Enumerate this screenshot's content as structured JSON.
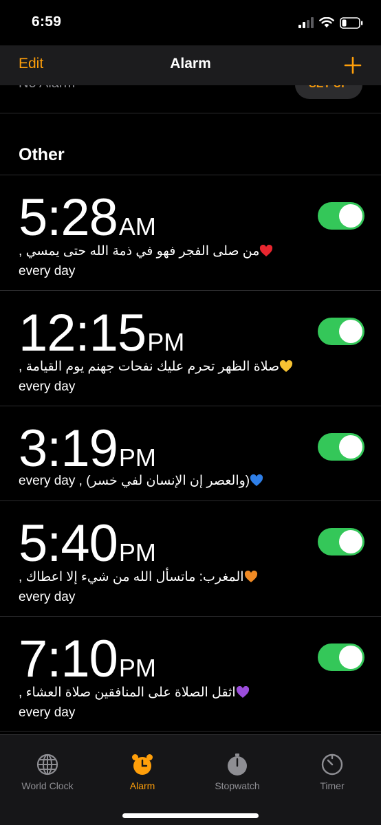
{
  "status": {
    "time": "6:59"
  },
  "nav": {
    "edit_label": "Edit",
    "title": "Alarm"
  },
  "peek": {
    "label": "No Alarm",
    "button": "SET UP"
  },
  "section": {
    "title": "Other"
  },
  "alarms": [
    {
      "time": "5:28",
      "ampm": "AM",
      "label": "من صلى الفجر فهو في ذمة الله حتى يمسي",
      "heart": "red",
      "repeat": ", every day",
      "enabled": true
    },
    {
      "time": "12:15",
      "ampm": "PM",
      "label": "صلاة الظهر تحرم عليك نفحات جهنم يوم القيامة",
      "heart": "yellow",
      "repeat": ", every day",
      "enabled": true
    },
    {
      "time": "3:19",
      "ampm": "PM",
      "label": "(والعصر إن الإنسان لفي خسر)",
      "heart": "blue",
      "repeat": "every day ,",
      "enabled": true
    },
    {
      "time": "5:40",
      "ampm": "PM",
      "label": "المغرب: ماتسأل الله من شيء إلا اعطاك",
      "heart": "orange",
      "repeat": ", every day",
      "enabled": true
    },
    {
      "time": "7:10",
      "ampm": "PM",
      "label": "اثقل الصلاة على المنافقين صلاة العشاء",
      "heart": "purple",
      "repeat": ", every day",
      "enabled": true
    }
  ],
  "tabs": [
    {
      "label": "World Clock",
      "icon": "globe-icon",
      "active": false
    },
    {
      "label": "Alarm",
      "icon": "alarm-clock-icon",
      "active": true
    },
    {
      "label": "Stopwatch",
      "icon": "stopwatch-icon",
      "active": false
    },
    {
      "label": "Timer",
      "icon": "timer-icon",
      "active": false
    }
  ],
  "colors": {
    "accent": "#ff9f0a",
    "toggle_on": "#34c759",
    "heart_red": "#e8262f",
    "heart_yellow": "#f7c232",
    "heart_blue": "#2f7fe8",
    "heart_orange": "#f08a24",
    "heart_purple": "#9b4ddb"
  }
}
